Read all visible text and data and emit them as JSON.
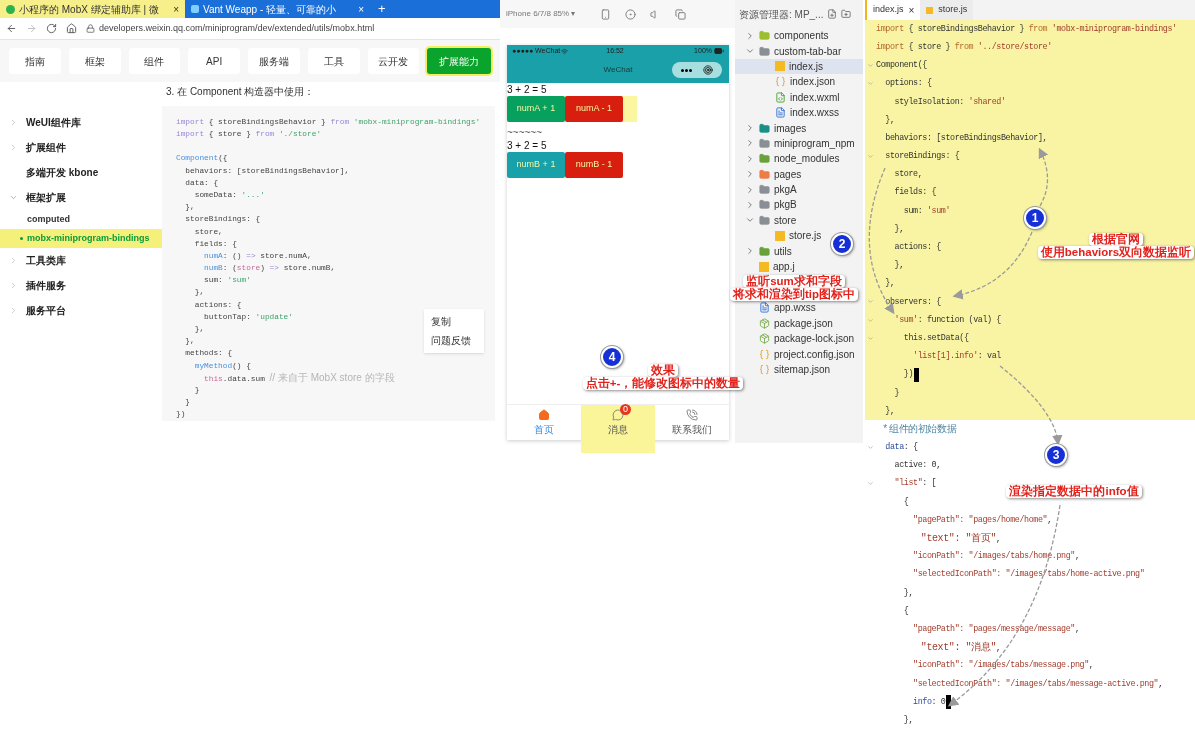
{
  "browser": {
    "tabs": [
      {
        "title": "小程序的 MobX 绑定辅助库 | 微",
        "selected": true,
        "close": "×"
      },
      {
        "title": "Vant Weapp - 轻量、可靠的小",
        "selected": false,
        "close": "×"
      }
    ],
    "new_tab": "+",
    "url": "developers.weixin.qq.com/miniprogram/dev/extended/utils/mobx.html",
    "nav": [
      {
        "label": "指南",
        "selected": false
      },
      {
        "label": "框架",
        "selected": false
      },
      {
        "label": "组件",
        "selected": false
      },
      {
        "label": "API",
        "selected": false
      },
      {
        "label": "服务端",
        "selected": false
      },
      {
        "label": "工具",
        "selected": false
      },
      {
        "label": "云开发",
        "selected": false
      },
      {
        "label": "扩展能力",
        "selected": true
      }
    ],
    "sidebar": [
      {
        "label": "WeUI组件库",
        "kind": "group",
        "expanded": false
      },
      {
        "label": "扩展组件",
        "kind": "group",
        "expanded": false
      },
      {
        "label": "多端开发 kbone",
        "kind": "link"
      },
      {
        "label": "框架扩展",
        "kind": "group",
        "expanded": true,
        "children": [
          {
            "label": "computed",
            "selected": false
          },
          {
            "label": "mobx-miniprogram-bindings",
            "selected": true
          }
        ]
      },
      {
        "label": "工具类库",
        "kind": "group",
        "expanded": false
      },
      {
        "label": "插件服务",
        "kind": "group",
        "expanded": false
      },
      {
        "label": "服务平台",
        "kind": "group",
        "expanded": false
      }
    ],
    "heading": "3. 在 Component 构造器中使用：",
    "code": [
      [
        {
          "text": "import",
          "kind": "kw"
        },
        {
          "text": " { storeBindingsBehavior } ",
          "kind": "plain"
        },
        {
          "text": "from",
          "kind": "kw"
        },
        {
          "text": " 'mobx-miniprogram-bindings'",
          "kind": "str"
        }
      ],
      [
        {
          "text": "import",
          "kind": "kw"
        },
        {
          "text": " { store } ",
          "kind": "plain"
        },
        {
          "text": "from",
          "kind": "kw"
        },
        {
          "text": " './store'",
          "kind": "str"
        }
      ],
      [
        {
          "text": "Component",
          "kind": "fn"
        },
        {
          "text": "({",
          "kind": "plain"
        }
      ],
      [
        {
          "text": "  behaviors: [storeBindingsBehavior],",
          "kind": "plain"
        }
      ],
      [
        {
          "text": "  data: {",
          "kind": "plain"
        }
      ],
      [
        {
          "text": "    someData: ",
          "kind": "plain"
        },
        {
          "text": "'...'",
          "kind": "str"
        }
      ],
      [
        {
          "text": "  },",
          "kind": "plain"
        }
      ],
      [
        {
          "text": "  storeBindings: {",
          "kind": "plain"
        }
      ],
      [
        {
          "text": "    store,",
          "kind": "plain"
        }
      ],
      [
        {
          "text": "    fields: {",
          "kind": "plain"
        }
      ],
      [
        {
          "text": "      numA",
          "kind": "fn"
        },
        {
          "text": ": () ",
          "kind": "plain"
        },
        {
          "text": "=>",
          "kind": "kw"
        },
        {
          "text": " store.numA,",
          "kind": "plain"
        }
      ],
      [
        {
          "text": "      numB",
          "kind": "fn"
        },
        {
          "text": ": (",
          "kind": "plain"
        },
        {
          "text": "store",
          "kind": "this"
        },
        {
          "text": ") ",
          "kind": "plain"
        },
        {
          "text": "=>",
          "kind": "kw"
        },
        {
          "text": " store.numB,",
          "kind": "plain"
        }
      ],
      [
        {
          "text": "      sum: ",
          "kind": "plain"
        },
        {
          "text": "'sum'",
          "kind": "str"
        }
      ],
      [
        {
          "text": "    },",
          "kind": "plain"
        }
      ],
      [
        {
          "text": "    actions: {",
          "kind": "plain"
        }
      ],
      [
        {
          "text": "      buttonTap: ",
          "kind": "plain"
        },
        {
          "text": "'update'",
          "kind": "str"
        }
      ],
      [
        {
          "text": "    },",
          "kind": "plain"
        }
      ],
      [
        {
          "text": "  },",
          "kind": "plain"
        }
      ],
      [
        {
          "text": "  methods: {",
          "kind": "plain"
        }
      ],
      [
        {
          "text": "    myMethod",
          "kind": "fn"
        },
        {
          "text": "() {",
          "kind": "plain"
        }
      ],
      [
        {
          "text": "      this",
          "kind": "this"
        },
        {
          "text": ".data.sum ",
          "kind": "plain"
        },
        {
          "text": "// 来自于 MobX store 的字段",
          "kind": "comment"
        }
      ],
      [
        {
          "text": "    }",
          "kind": "plain"
        }
      ],
      [
        {
          "text": "  }",
          "kind": "plain"
        }
      ],
      [
        {
          "text": "})",
          "kind": "plain"
        }
      ]
    ],
    "context_menu": [
      "复制",
      "问题反馈"
    ]
  },
  "simulator": {
    "device": "iPhone 6/7/8 85% ▾",
    "carrier": "●●●●● WeChat",
    "time": "16:52",
    "battery": "100%",
    "title": "WeChat",
    "rows": [
      {
        "kind": "text",
        "text": "3 + 2 = 5"
      },
      {
        "kind": "buttons",
        "highlighted": true,
        "buttons": [
          {
            "label": "numA + 1",
            "color": "#07a05f"
          },
          {
            "label": "numA - 1",
            "color": "#d81e0f"
          }
        ]
      },
      {
        "kind": "text",
        "text": "~~~~~~"
      },
      {
        "kind": "text",
        "text": "3 + 2 = 5"
      },
      {
        "kind": "buttons",
        "highlighted": false,
        "buttons": [
          {
            "label": "numB + 1",
            "color": "#19a1aa"
          },
          {
            "label": "numB - 1",
            "color": "#d81e0f"
          }
        ]
      }
    ],
    "tabbar": [
      {
        "label": "首页",
        "kind": "home",
        "selected": true,
        "highlighted": false
      },
      {
        "label": "消息",
        "kind": "message",
        "selected": false,
        "highlighted": true,
        "badge": "0"
      },
      {
        "label": "联系我们",
        "kind": "contact",
        "selected": false,
        "highlighted": false
      }
    ]
  },
  "explorer": {
    "title": "资源管理器: MP_...",
    "tree": [
      {
        "label": "components",
        "kind": "folder",
        "color": "#9cbf2e",
        "expanded": false
      },
      {
        "label": "custom-tab-bar",
        "kind": "folder",
        "color": "#8a8f96",
        "expanded": true,
        "children": [
          {
            "label": "index.js",
            "kind": "js",
            "selected": true
          },
          {
            "label": "index.json",
            "kind": "json",
            "selected": false
          },
          {
            "label": "index.wxml",
            "kind": "wxml",
            "selected": false
          },
          {
            "label": "index.wxss",
            "kind": "wxss",
            "selected": false
          }
        ]
      },
      {
        "label": "images",
        "kind": "folder",
        "color": "#1a8f86",
        "expanded": false
      },
      {
        "label": "miniprogram_npm",
        "kind": "folder",
        "color": "#8a8f96",
        "expanded": false
      },
      {
        "label": "node_modules",
        "kind": "folder",
        "color": "#6aa13a",
        "expanded": false
      },
      {
        "label": "pages",
        "kind": "folder",
        "color": "#ef7b45",
        "expanded": false
      },
      {
        "label": "pkgA",
        "kind": "folder",
        "color": "#8a8f96",
        "expanded": false
      },
      {
        "label": "pkgB",
        "kind": "folder",
        "color": "#8a8f96",
        "expanded": false
      },
      {
        "label": "store",
        "kind": "folder",
        "color": "#8a8f96",
        "expanded": true,
        "children": [
          {
            "label": "store.js",
            "kind": "js",
            "selected": false
          }
        ]
      },
      {
        "label": "utils",
        "kind": "folder",
        "color": "#6aa13a",
        "expanded": false
      },
      {
        "label": "app.j",
        "kind": "js",
        "selected": false
      },
      {
        "label": "app.wxss",
        "kind": "wxss",
        "selected": false
      },
      {
        "label": "package.json",
        "kind": "package",
        "selected": false
      },
      {
        "label": "package-lock.json",
        "kind": "package",
        "selected": false
      },
      {
        "label": "project.config.json",
        "kind": "json",
        "selected": false
      },
      {
        "label": "sitemap.json",
        "kind": "json",
        "selected": false
      }
    ]
  },
  "editor": {
    "tabs": [
      {
        "label": "index.js",
        "selected": true,
        "close": "×"
      },
      {
        "label": "store.js",
        "selected": false
      }
    ],
    "lines": [
      {
        "segs": [
          {
            "text": "import",
            "kind": "kw"
          },
          {
            "text": " { storeBindingsBehavior } ",
            "kind": "plain"
          },
          {
            "text": "from",
            "kind": "kw"
          },
          {
            "text": " 'mobx-miniprogram-bindings'",
            "kind": "str"
          }
        ],
        "highlighted": true,
        "fold": false,
        "cursor": false
      },
      {
        "segs": [
          {
            "text": "import",
            "kind": "kw"
          },
          {
            "text": " { store } ",
            "kind": "plain"
          },
          {
            "text": "from",
            "kind": "kw"
          },
          {
            "text": " '../store/store'",
            "kind": "str"
          }
        ],
        "highlighted": true,
        "fold": false,
        "cursor": false
      },
      {
        "segs": [
          {
            "text": "Component({",
            "kind": "plain"
          }
        ],
        "highlighted": true,
        "fold": true,
        "cursor": false
      },
      {
        "segs": [
          {
            "text": "  options: {",
            "kind": "plain"
          }
        ],
        "highlighted": true,
        "fold": true,
        "cursor": false
      },
      {
        "segs": [
          {
            "text": "    styleIsolation: ",
            "kind": "plain"
          },
          {
            "text": "'shared'",
            "kind": "str"
          }
        ],
        "highlighted": true,
        "fold": false,
        "cursor": false
      },
      {
        "segs": [
          {
            "text": "  },",
            "kind": "plain"
          }
        ],
        "highlighted": true,
        "fold": false,
        "cursor": false
      },
      {
        "segs": [
          {
            "text": "  behaviors: [storeBindingsBehavior],",
            "kind": "plain"
          }
        ],
        "highlighted": true,
        "fold": false,
        "cursor": false
      },
      {
        "segs": [
          {
            "text": "  storeBindings: {",
            "kind": "plain"
          }
        ],
        "highlighted": true,
        "fold": true,
        "cursor": false
      },
      {
        "segs": [
          {
            "text": "    store,",
            "kind": "plain"
          }
        ],
        "highlighted": true,
        "fold": false,
        "cursor": false
      },
      {
        "segs": [
          {
            "text": "    fields: {",
            "kind": "plain"
          }
        ],
        "highlighted": true,
        "fold": false,
        "cursor": false
      },
      {
        "segs": [
          {
            "text": "      sum: ",
            "kind": "plain"
          },
          {
            "text": "'sum'",
            "kind": "str"
          }
        ],
        "highlighted": true,
        "fold": false,
        "cursor": false
      },
      {
        "segs": [
          {
            "text": "    },",
            "kind": "plain"
          }
        ],
        "highlighted": true,
        "fold": false,
        "cursor": false
      },
      {
        "segs": [
          {
            "text": "    actions: {",
            "kind": "plain"
          }
        ],
        "highlighted": true,
        "fold": false,
        "cursor": false
      },
      {
        "segs": [
          {
            "text": "    },",
            "kind": "plain"
          }
        ],
        "highlighted": true,
        "fold": false,
        "cursor": false
      },
      {
        "segs": [
          {
            "text": "  },",
            "kind": "plain"
          }
        ],
        "highlighted": true,
        "fold": false,
        "cursor": false
      },
      {
        "segs": [
          {
            "text": "  observers: {",
            "kind": "plain"
          }
        ],
        "highlighted": true,
        "fold": true,
        "cursor": false
      },
      {
        "segs": [
          {
            "text": "    'sum'",
            "kind": "str"
          },
          {
            "text": ": function (val) {",
            "kind": "plain"
          }
        ],
        "highlighted": true,
        "fold": true,
        "cursor": false
      },
      {
        "segs": [
          {
            "text": "      this.setData({",
            "kind": "plain"
          }
        ],
        "highlighted": true,
        "fold": true,
        "cursor": false
      },
      {
        "segs": [
          {
            "text": "        'list[1].info'",
            "kind": "str"
          },
          {
            "text": ": val",
            "kind": "plain"
          }
        ],
        "highlighted": true,
        "fold": false,
        "cursor": false
      },
      {
        "segs": [
          {
            "text": "      })",
            "kind": "plain"
          }
        ],
        "highlighted": true,
        "fold": false,
        "cursor": true
      },
      {
        "segs": [
          {
            "text": "    }",
            "kind": "plain"
          }
        ],
        "highlighted": true,
        "fold": false,
        "cursor": false
      },
      {
        "segs": [
          {
            "text": "  },",
            "kind": "plain"
          }
        ],
        "highlighted": true,
        "fold": false,
        "cursor": false
      },
      {
        "segs": [
          {
            "text": "   * 组件的初始数据",
            "kind": "comment"
          }
        ],
        "highlighted": false,
        "fold": false,
        "cursor": false
      },
      {
        "segs": [
          {
            "text": "  data",
            "kind": "key"
          },
          {
            "text": ": {",
            "kind": "plain"
          }
        ],
        "highlighted": false,
        "fold": true,
        "cursor": false
      },
      {
        "segs": [
          {
            "text": "    active: 0,",
            "kind": "plain"
          }
        ],
        "highlighted": false,
        "fold": false,
        "cursor": false
      },
      {
        "segs": [
          {
            "text": "    \"list\"",
            "kind": "str"
          },
          {
            "text": ": [",
            "kind": "plain"
          }
        ],
        "highlighted": false,
        "fold": true,
        "cursor": false
      },
      {
        "segs": [
          {
            "text": "      {",
            "kind": "plain"
          }
        ],
        "highlighted": false,
        "fold": false,
        "cursor": false
      },
      {
        "segs": [
          {
            "text": "        \"pagePath\": \"pages/home/home\"",
            "kind": "str"
          },
          {
            "text": ",",
            "kind": "plain"
          }
        ],
        "highlighted": false,
        "fold": false,
        "cursor": false
      },
      {
        "segs": [
          {
            "text": "        \"text\": \"首页\"",
            "kind": "str_cjk"
          },
          {
            "text": ",",
            "kind": "plain"
          }
        ],
        "highlighted": false,
        "fold": false,
        "cursor": false
      },
      {
        "segs": [
          {
            "text": "        \"iconPath\": \"/images/tabs/home.png\"",
            "kind": "str"
          },
          {
            "text": ",",
            "kind": "plain"
          }
        ],
        "highlighted": false,
        "fold": false,
        "cursor": false
      },
      {
        "segs": [
          {
            "text": "        \"selectedIconPath\": \"/images/tabs/home-active.png\"",
            "kind": "str"
          }
        ],
        "highlighted": false,
        "fold": false,
        "cursor": false
      },
      {
        "segs": [
          {
            "text": "      },",
            "kind": "plain"
          }
        ],
        "highlighted": false,
        "fold": false,
        "cursor": false
      },
      {
        "segs": [
          {
            "text": "      {",
            "kind": "plain"
          }
        ],
        "highlighted": false,
        "fold": false,
        "cursor": false
      },
      {
        "segs": [
          {
            "text": "        \"pagePath\": \"pages/message/message\"",
            "kind": "str"
          },
          {
            "text": ",",
            "kind": "plain"
          }
        ],
        "highlighted": false,
        "fold": false,
        "cursor": false
      },
      {
        "segs": [
          {
            "text": "        \"text\": \"消息\"",
            "kind": "str_cjk"
          },
          {
            "text": ",",
            "kind": "plain"
          }
        ],
        "highlighted": false,
        "fold": false,
        "cursor": false
      },
      {
        "segs": [
          {
            "text": "        \"iconPath\": \"/images/tabs/message.png\"",
            "kind": "str"
          },
          {
            "text": ",",
            "kind": "plain"
          }
        ],
        "highlighted": false,
        "fold": false,
        "cursor": false
      },
      {
        "segs": [
          {
            "text": "        \"selectedIconPath\": \"/images/tabs/message-active.png\"",
            "kind": "str"
          },
          {
            "text": ",",
            "kind": "plain"
          }
        ],
        "highlighted": false,
        "fold": false,
        "cursor": false
      },
      {
        "segs": [
          {
            "text": "        info",
            "kind": "key"
          },
          {
            "text": ": 0",
            "kind": "plain"
          }
        ],
        "highlighted": false,
        "fold": false,
        "cursor": true
      },
      {
        "segs": [
          {
            "text": "      },",
            "kind": "plain"
          }
        ],
        "highlighted": false,
        "fold": false,
        "cursor": false
      }
    ]
  },
  "annotations": [
    {
      "number": "1",
      "lines": [
        "根据官网",
        "使用behaviors双向数据监听"
      ]
    },
    {
      "number": "2",
      "lines": [
        "监听sum求和字段",
        "将求和渲染到tip图标中"
      ]
    },
    {
      "number": "3",
      "lines": [
        "渲染指定数据中的info值"
      ]
    },
    {
      "number": "4",
      "lines": [
        "效果",
        "点击+-，能修改图标中的数量"
      ]
    }
  ]
}
